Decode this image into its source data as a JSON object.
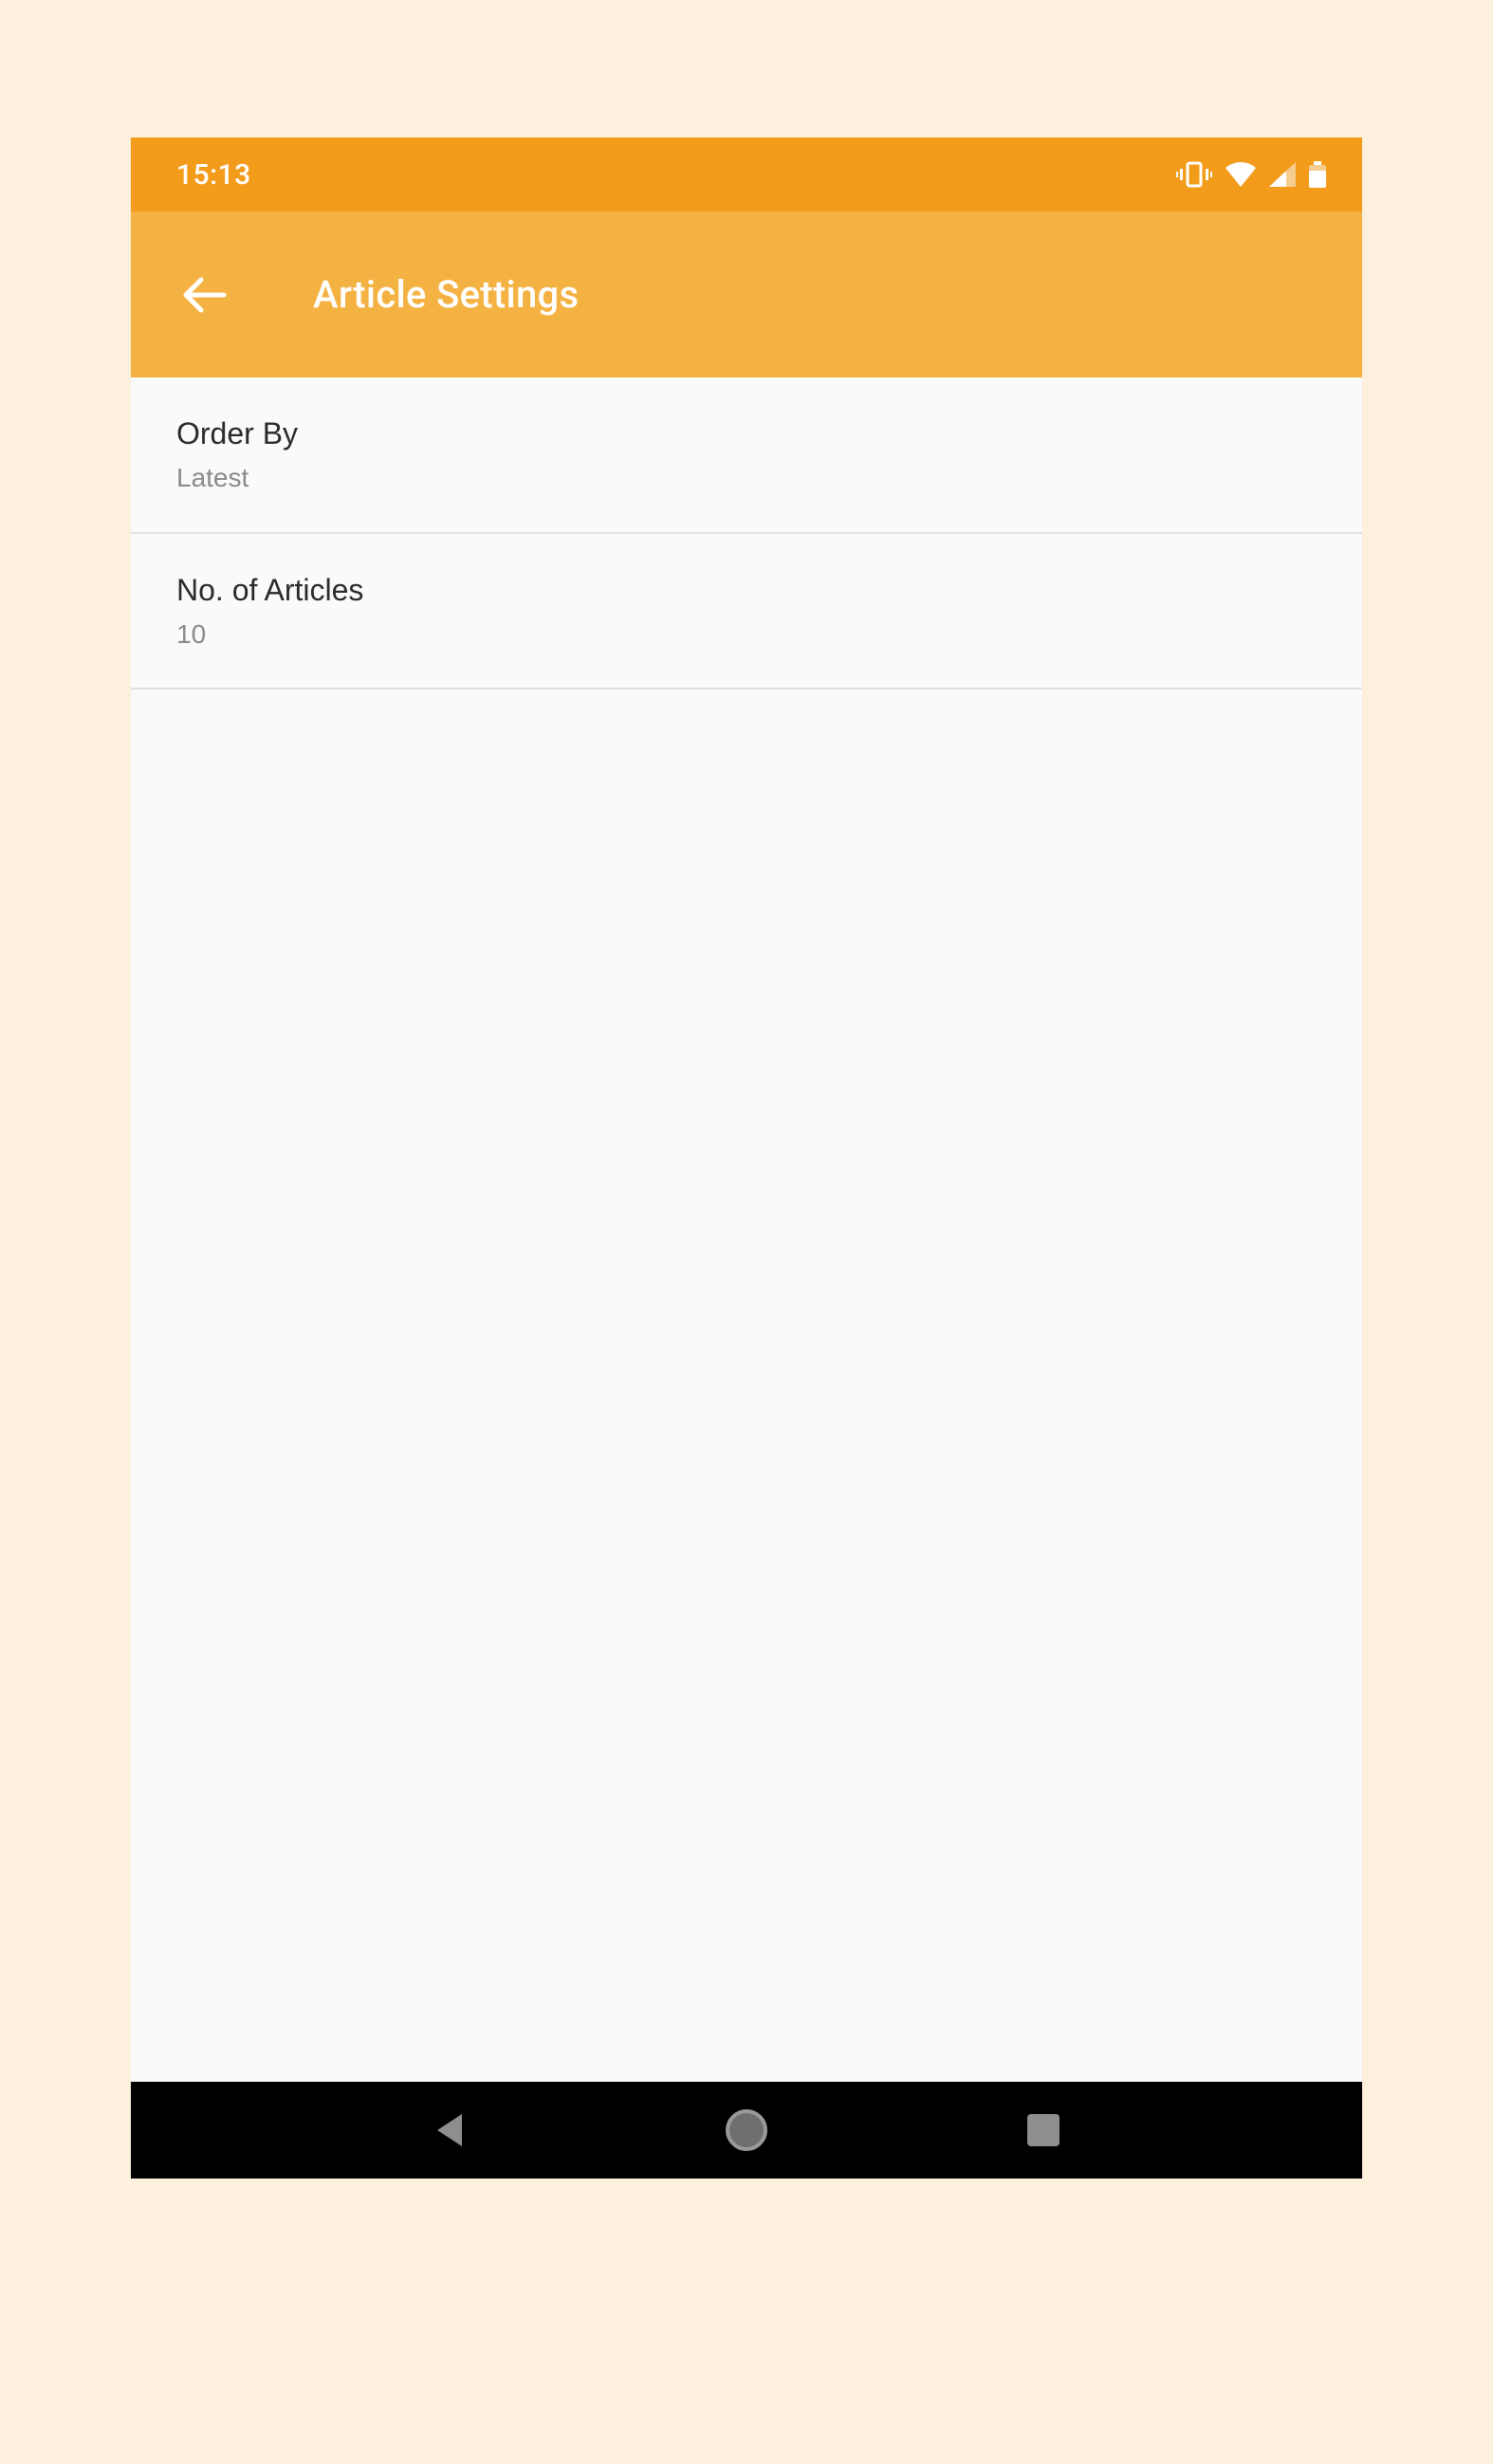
{
  "status_bar": {
    "time": "15:13"
  },
  "app_bar": {
    "title": "Article Settings"
  },
  "settings": {
    "order_by": {
      "label": "Order By",
      "value": "Latest"
    },
    "num_articles": {
      "label": "No. of Articles",
      "value": "10"
    }
  }
}
